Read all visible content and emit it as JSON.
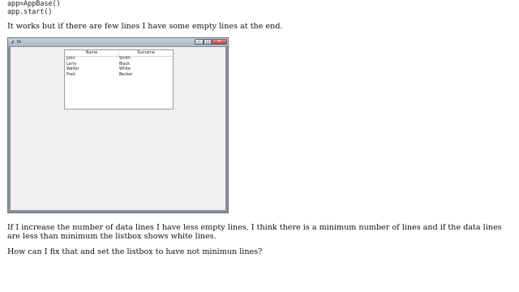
{
  "code": {
    "line1": "app=AppBase()",
    "line2": "app.start()"
  },
  "post": {
    "paragraph1": "It works but if there are few lines I have some empty lines at the end.",
    "paragraph2": "If I increase the number of data lines I have less empty lines, I think there is a minimum number of lines and if the data lines are less than minimum the listbox shows white lines.",
    "paragraph3": "How can I fix that and set the listbox to have not minimun lines?"
  },
  "window": {
    "title": "tk",
    "icon": "feather-icon",
    "controls": {
      "minimize": "–",
      "maximize": "□",
      "close": "✕"
    },
    "listbox": {
      "columns": [
        "Name",
        "Surname"
      ],
      "rows": [
        {
          "name": "John",
          "surname": "Smith"
        },
        {
          "name": "Larry",
          "surname": "Black"
        },
        {
          "name": "Walter",
          "surname": "White"
        },
        {
          "name": "Fred",
          "surname": "Becker"
        }
      ]
    }
  }
}
